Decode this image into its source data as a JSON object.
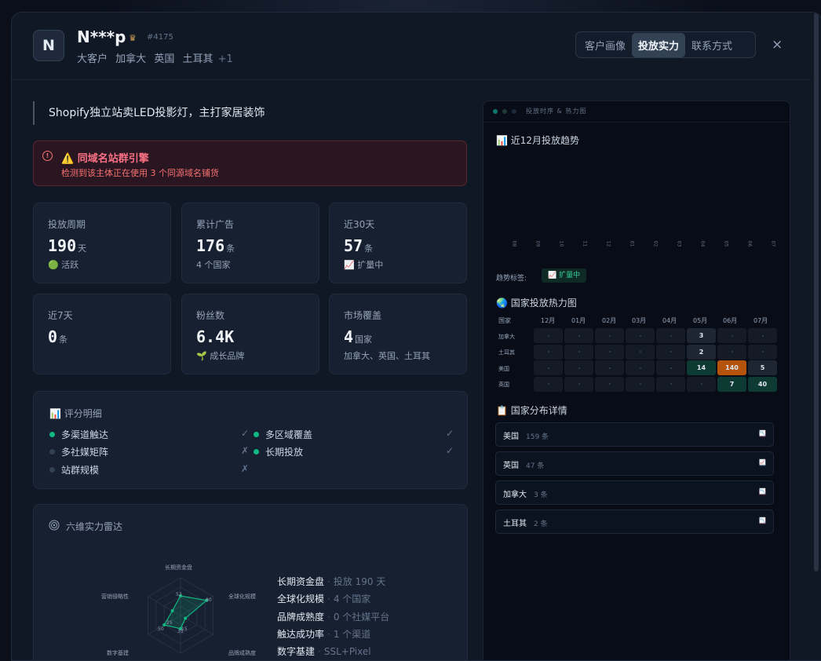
{
  "header": {
    "avatar_letter": "N",
    "name": "N***p",
    "crown_icon": "♛",
    "customer_id": "#4175",
    "tags": [
      "大客户",
      "加拿大",
      "英国",
      "土耳其"
    ],
    "more": "+1",
    "tabs": [
      "客户画像",
      "投放实力",
      "联系方式"
    ],
    "active_tab": "投放实力",
    "close_icon": "×"
  },
  "description": "Shopify独立站卖LED投影灯，主打家居装饰",
  "alert": {
    "icon": "!",
    "title": "⚠️ 同域名站群引擎",
    "text": "检测到该主体正在使用 3 个同源域名铺货"
  },
  "stats": [
    {
      "label": "投放周期",
      "value": "190",
      "unit": "天",
      "note": "🟢 活跃"
    },
    {
      "label": "累计广告",
      "value": "176",
      "unit": "条",
      "note": "4 个国家"
    },
    {
      "label": "近30天",
      "value": "57",
      "unit": "条",
      "note": "📈 扩量中"
    },
    {
      "label": "近7天",
      "value": "0",
      "unit": "条",
      "note": ""
    },
    {
      "label": "粉丝数",
      "value": "6.4K",
      "unit": "",
      "note": "🌱 成长品牌"
    },
    {
      "label": "市场覆盖",
      "value": "4",
      "unit": "国家",
      "note": "加拿大、英国、土耳其"
    }
  ],
  "score": {
    "title": "📊 评分明细",
    "items": [
      {
        "label": "多渠道触达",
        "mark": "✓",
        "active": true
      },
      {
        "label": "多区域覆盖",
        "mark": "✓",
        "active": true
      },
      {
        "label": "多社媒矩阵",
        "mark": "✗",
        "active": false
      },
      {
        "label": "长期投放",
        "mark": "✓",
        "active": true
      },
      {
        "label": "站群规模",
        "mark": "✗",
        "active": false
      }
    ]
  },
  "radar": {
    "title": "六维实力雷达",
    "axes": [
      "长期资金盘",
      "全球化规模",
      "品牌成熟度",
      "触达成功率",
      "数字基建",
      "营销侵略性"
    ],
    "values": [
      52,
      80,
      15,
      35,
      50,
      25
    ],
    "value_labels": [
      "52",
      "80",
      "15",
      "35",
      "50",
      "25"
    ],
    "legend": [
      {
        "label": "长期资金盘",
        "value": "投放 190 天"
      },
      {
        "label": "全球化规模",
        "value": "4 个国家"
      },
      {
        "label": "品牌成熟度",
        "value": "0 个社媒平台"
      },
      {
        "label": "触达成功率",
        "value": "1 个渠道"
      },
      {
        "label": "数字基建",
        "value": "SSL+Pixel"
      }
    ]
  },
  "right": {
    "terminal_title": "投放时序 & 热力图",
    "trend_title": "📊 近12月投放趋势",
    "months": [
      "08",
      "09",
      "10",
      "11",
      "12",
      "01",
      "02",
      "03",
      "04",
      "05",
      "06",
      "07"
    ],
    "trend_label": "趋势标签:",
    "trend_tag": "📈 扩量中",
    "heatmap_title": "🌏 国家投放热力图",
    "heatmap": {
      "corner": "国家",
      "columns": [
        "12月",
        "01月",
        "02月",
        "03月",
        "04月",
        "05月",
        "06月",
        "07月"
      ],
      "rows": [
        {
          "country": "加拿大",
          "values": [
            "",
            "",
            "",
            "",
            "",
            "3",
            "",
            ""
          ]
        },
        {
          "country": "土耳其",
          "values": [
            "",
            "",
            "",
            "",
            "",
            "2",
            "",
            ""
          ]
        },
        {
          "country": "美国",
          "values": [
            "",
            "",
            "",
            "",
            "",
            "14",
            "140",
            "5"
          ]
        },
        {
          "country": "英国",
          "values": [
            "",
            "",
            "",
            "",
            "",
            "",
            "7",
            "40"
          ]
        }
      ]
    },
    "country_title": "📋 国家分布详情",
    "countries": [
      {
        "name": "美国",
        "count": "159 条",
        "trend": "📉",
        "color": "#f472b6"
      },
      {
        "name": "英国",
        "count": "47 条",
        "trend": "📈",
        "color": "#60a5fa"
      },
      {
        "name": "加拿大",
        "count": "3 条",
        "trend": "📉",
        "color": "#f472b6"
      },
      {
        "name": "土耳其",
        "count": "2 条",
        "trend": "📉",
        "color": "#f472b6"
      }
    ]
  },
  "colors": {
    "accent_green": "#10b981",
    "alert_red": "#fb7185",
    "orange": "#b45309",
    "teal": "#0d3b33"
  }
}
